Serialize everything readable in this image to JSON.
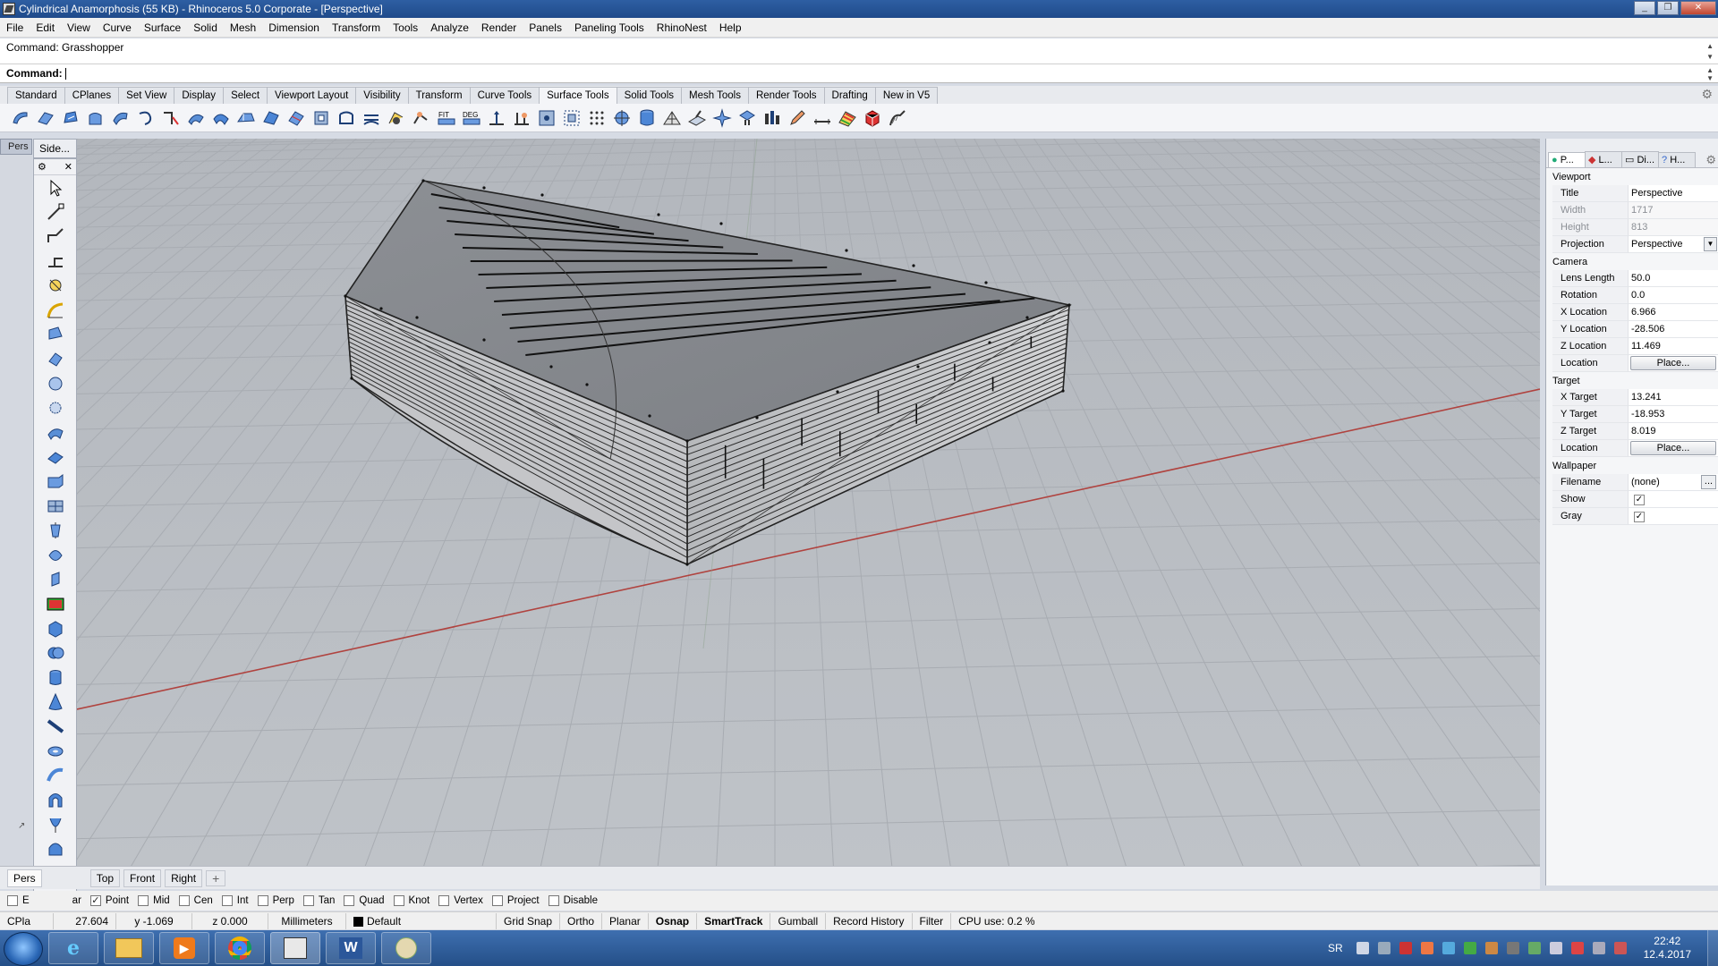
{
  "window": {
    "title": "Cylindrical Anamorphosis (55 KB) - Rhinoceros  5.0 Corporate - [Perspective]"
  },
  "menu": [
    "File",
    "Edit",
    "View",
    "Curve",
    "Surface",
    "Solid",
    "Mesh",
    "Dimension",
    "Transform",
    "Tools",
    "Analyze",
    "Render",
    "Panels",
    "Paneling Tools",
    "RhinoNest",
    "Help"
  ],
  "command": {
    "history": "Command: Grasshopper",
    "prompt": "Command:"
  },
  "toolbar_tabs": [
    "Standard",
    "CPlanes",
    "Set View",
    "Display",
    "Select",
    "Viewport Layout",
    "Visibility",
    "Transform",
    "Curve Tools",
    "Surface Tools",
    "Solid Tools",
    "Mesh Tools",
    "Render Tools",
    "Drafting",
    "New in V5"
  ],
  "active_tab": "Surface Tools",
  "sidebar": {
    "title": "Side...",
    "persp_tab": "Pers"
  },
  "viewport_tabs": [
    "Pers",
    "Top",
    "Front",
    "Right"
  ],
  "osnaps": [
    {
      "label": "E",
      "checked": false
    },
    {
      "label": "ar",
      "checked": false
    },
    {
      "label": "Point",
      "checked": true
    },
    {
      "label": "Mid",
      "checked": false
    },
    {
      "label": "Cen",
      "checked": false
    },
    {
      "label": "Int",
      "checked": false
    },
    {
      "label": "Perp",
      "checked": false
    },
    {
      "label": "Tan",
      "checked": false
    },
    {
      "label": "Quad",
      "checked": false
    },
    {
      "label": "Knot",
      "checked": false
    },
    {
      "label": "Vertex",
      "checked": false
    },
    {
      "label": "Project",
      "checked": false
    },
    {
      "label": "Disable",
      "checked": false
    }
  ],
  "status": {
    "cplane": "CPla",
    "x": "27.604",
    "y": "y -1.069",
    "z": "z 0.000",
    "units": "Millimeters",
    "layer": "Default",
    "grid_snap": "Grid Snap",
    "ortho": "Ortho",
    "planar": "Planar",
    "osnap": "Osnap",
    "smarttrack": "SmartTrack",
    "gumball": "Gumball",
    "record_history": "Record History",
    "filter": "Filter",
    "cpu": "CPU use: 0.2 %"
  },
  "panel": {
    "tabs": [
      "P...",
      "L...",
      "Di...",
      "H..."
    ],
    "viewport_section": "Viewport",
    "title_label": "Title",
    "title_value": "Perspective",
    "width_label": "Width",
    "width_value": "1717",
    "height_label": "Height",
    "height_value": "813",
    "projection_label": "Projection",
    "projection_value": "Perspective",
    "camera_section": "Camera",
    "lens_label": "Lens Length",
    "lens_value": "50.0",
    "rotation_label": "Rotation",
    "rotation_value": "0.0",
    "xloc_label": "X Location",
    "xloc_value": "6.966",
    "yloc_label": "Y Location",
    "yloc_value": "-28.506",
    "zloc_label": "Z Location",
    "zloc_value": "11.469",
    "location_label": "Location",
    "place_button": "Place...",
    "target_section": "Target",
    "xt_label": "X Target",
    "xt_value": "13.241",
    "yt_label": "Y Target",
    "yt_value": "-18.953",
    "zt_label": "Z Target",
    "zt_value": "8.019",
    "tlocation_label": "Location",
    "tplace_button": "Place...",
    "wallpaper_section": "Wallpaper",
    "filename_label": "Filename",
    "filename_value": "(none)",
    "browse_button": "...",
    "show_label": "Show",
    "gray_label": "Gray"
  },
  "tray": {
    "lang": "SR",
    "time": "22:42",
    "date": "12.4.2017"
  }
}
